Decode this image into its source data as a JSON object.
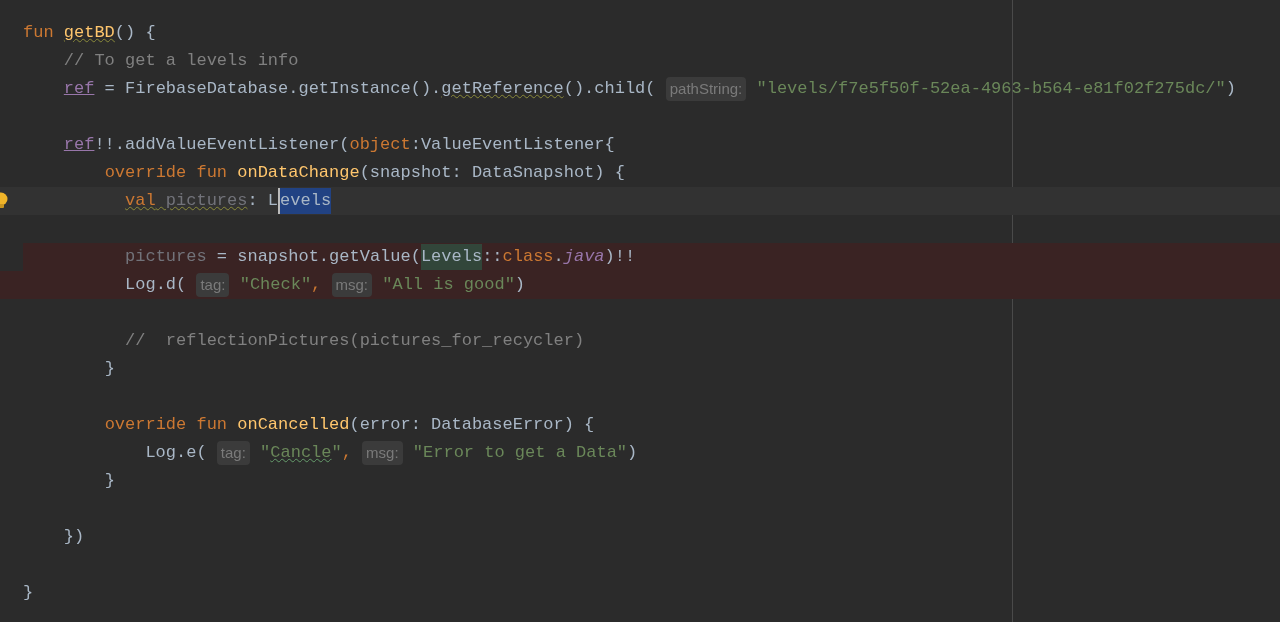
{
  "lines": [
    {
      "blank_before": false,
      "current": false,
      "error": false,
      "bulb": false,
      "tokens": [
        {
          "kind": "keyword",
          "text": "fun "
        },
        {
          "kind": "function_warn",
          "text": "getBD"
        },
        {
          "kind": "plain",
          "text": "() {"
        }
      ]
    },
    {
      "blank_before": false,
      "current": false,
      "error": false,
      "bulb": false,
      "tokens": [
        {
          "kind": "comment",
          "text": "    // To get a levels info"
        }
      ]
    },
    {
      "blank_before": false,
      "current": false,
      "error": false,
      "bulb": false,
      "tokens": [
        {
          "kind": "property",
          "text": "    ref"
        },
        {
          "kind": "plain",
          "text": " = FirebaseDatabase.getInstance()."
        },
        {
          "kind": "plain_warn",
          "text": "getReference"
        },
        {
          "kind": "plain",
          "text": "().child( "
        },
        {
          "kind": "hint",
          "text": "pathString:"
        },
        {
          "kind": "string",
          "text": " \"levels/f7e5f50f-52ea-4963-b564-e81f02f275dc/\""
        },
        {
          "kind": "plain",
          "text": ")"
        }
      ]
    },
    {
      "blank_before": true,
      "current": false,
      "error": false,
      "bulb": false,
      "tokens": [
        {
          "kind": "property",
          "text": "    ref"
        },
        {
          "kind": "plain",
          "text": "!!.addValueEventListener("
        },
        {
          "kind": "keyword",
          "text": "object"
        },
        {
          "kind": "plain",
          "text": ":ValueEventListener{"
        }
      ]
    },
    {
      "blank_before": false,
      "current": false,
      "error": false,
      "bulb": false,
      "tokens": [
        {
          "kind": "keyword",
          "text": "        override fun "
        },
        {
          "kind": "function",
          "text": "onDataChange"
        },
        {
          "kind": "plain",
          "text": "(snapshot: DataSnapshot) {"
        }
      ]
    },
    {
      "blank_before": false,
      "current": true,
      "error": false,
      "bulb": true,
      "tokens": [
        {
          "kind": "keyword_warn",
          "text": "          val"
        },
        {
          "kind": "unused_warn",
          "text": " pictures"
        },
        {
          "kind": "plain",
          "text": ": L"
        },
        {
          "kind": "selected",
          "text": "evels"
        }
      ]
    },
    {
      "blank_before": true,
      "current": false,
      "error": true,
      "bulb": false,
      "tokens": [
        {
          "kind": "unused",
          "text": "          pictures"
        },
        {
          "kind": "plain",
          "text": " = snapshot.getValue("
        },
        {
          "kind": "match",
          "text": "Levels"
        },
        {
          "kind": "plain",
          "text": "::"
        },
        {
          "kind": "keyword",
          "text": "class"
        },
        {
          "kind": "plain",
          "text": "."
        },
        {
          "kind": "italic_property",
          "text": "java"
        },
        {
          "kind": "plain",
          "text": ")!!"
        }
      ]
    },
    {
      "blank_before": false,
      "current": false,
      "error": true,
      "bulb": false,
      "tokens": [
        {
          "kind": "plain",
          "text": "          Log.d( "
        },
        {
          "kind": "hint",
          "text": "tag:"
        },
        {
          "kind": "string",
          "text": " \"Check\""
        },
        {
          "kind": "keyword",
          "text": ", "
        },
        {
          "kind": "hint",
          "text": "msg:"
        },
        {
          "kind": "string",
          "text": " \"All is good\""
        },
        {
          "kind": "plain",
          "text": ")"
        }
      ]
    },
    {
      "blank_before": true,
      "current": false,
      "error": false,
      "bulb": false,
      "tokens": [
        {
          "kind": "comment",
          "text": "          //  reflectionPictures(pictures_for_recycler)"
        }
      ]
    },
    {
      "blank_before": false,
      "current": false,
      "error": false,
      "bulb": false,
      "tokens": [
        {
          "kind": "plain",
          "text": "        }"
        }
      ]
    },
    {
      "blank_before": true,
      "current": false,
      "error": false,
      "bulb": false,
      "tokens": [
        {
          "kind": "keyword",
          "text": "        override fun "
        },
        {
          "kind": "function",
          "text": "onCancelled"
        },
        {
          "kind": "plain",
          "text": "(error: DatabaseError) {"
        }
      ]
    },
    {
      "blank_before": false,
      "current": false,
      "error": false,
      "bulb": false,
      "tokens": [
        {
          "kind": "plain",
          "text": "            Log.e( "
        },
        {
          "kind": "hint",
          "text": "tag:"
        },
        {
          "kind": "string",
          "text": " \""
        },
        {
          "kind": "string_typo",
          "text": "Cancle"
        },
        {
          "kind": "string",
          "text": "\""
        },
        {
          "kind": "keyword",
          "text": ", "
        },
        {
          "kind": "hint",
          "text": "msg:"
        },
        {
          "kind": "string",
          "text": " \"Error to get a Data\""
        },
        {
          "kind": "plain",
          "text": ")"
        }
      ]
    },
    {
      "blank_before": false,
      "current": false,
      "error": false,
      "bulb": false,
      "tokens": [
        {
          "kind": "plain",
          "text": "        }"
        }
      ]
    },
    {
      "blank_before": true,
      "current": false,
      "error": false,
      "bulb": false,
      "tokens": [
        {
          "kind": "plain",
          "text": "    })"
        }
      ]
    },
    {
      "blank_before": true,
      "current": false,
      "error": false,
      "bulb": false,
      "tokens": [
        {
          "kind": "plain",
          "text": "}"
        }
      ]
    }
  ]
}
